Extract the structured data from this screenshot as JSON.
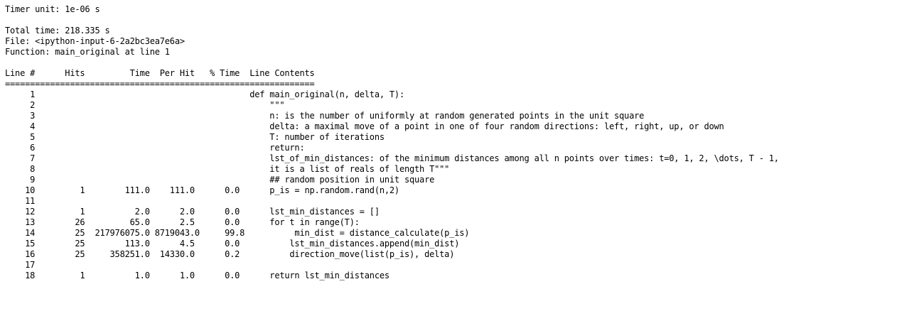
{
  "header": {
    "timer_unit": "Timer unit: 1e-06 s",
    "total_time": "Total time: 218.335 s",
    "file": "File: <ipython-input-6-2a2bc3ea7e6a>",
    "function": "Function: main_original at line 1"
  },
  "table": {
    "header_row": "Line #      Hits         Time  Per Hit   % Time  Line Contents",
    "separator": "==============================================================",
    "rows": [
      "     1                                           def main_original(n, delta, T):",
      "     2                                               \"\"\"",
      "     3                                               n: is the number of uniformly at random generated points in the unit square",
      "     4                                               delta: a maximal move of a point in one of four random directions: left, right, up, or down",
      "     5                                               T: number of iterations",
      "     6                                               return:",
      "     7                                               lst_of_min_distances: of the minimum distances among all n points over times: t=0, 1, 2, \\dots, T - 1,",
      "     8                                               it is a list of reals of length T\"\"\"",
      "     9                                               ## random position in unit square",
      "    10         1        111.0    111.0      0.0      p_is = np.random.rand(n,2)",
      "    11",
      "    12         1          2.0      2.0      0.0      lst_min_distances = []",
      "    13        26         65.0      2.5      0.0      for t in range(T):",
      "    14        25  217976075.0 8719043.0     99.8          min_dist = distance_calculate(p_is)",
      "    15        25        113.0      4.5      0.0          lst_min_distances.append(min_dist)",
      "    16        25     358251.0  14330.0      0.2          direction_move(list(p_is), delta)",
      "    17",
      "    18         1          1.0      1.0      0.0      return lst_min_distances"
    ]
  }
}
